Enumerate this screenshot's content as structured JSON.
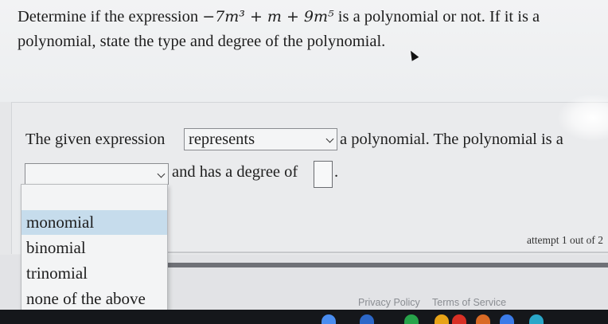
{
  "question": {
    "text_before": "Determine if the expression ",
    "expression": "−7m³ + m + 9m⁵",
    "text_after": " is a polynomial or not. If it is a polynomial, state the type and degree of the polynomial."
  },
  "answer": {
    "prefix": "The given expression",
    "represents_value": "represents",
    "mid_text": "a polynomial. The polynomial is a",
    "type_value": "",
    "degree_text": "and has a degree of",
    "period": "."
  },
  "dropdown": {
    "options": [
      "monomial",
      "binomial",
      "trinomial",
      "none of the above"
    ],
    "highlighted_index": 0
  },
  "status": {
    "attempt": "attempt 1 out of 2"
  },
  "footer": {
    "privacy": "Privacy Policy",
    "terms": "Terms of Service"
  },
  "colors": {
    "highlight": "#c6dcec",
    "background": "#e6e7e9"
  }
}
